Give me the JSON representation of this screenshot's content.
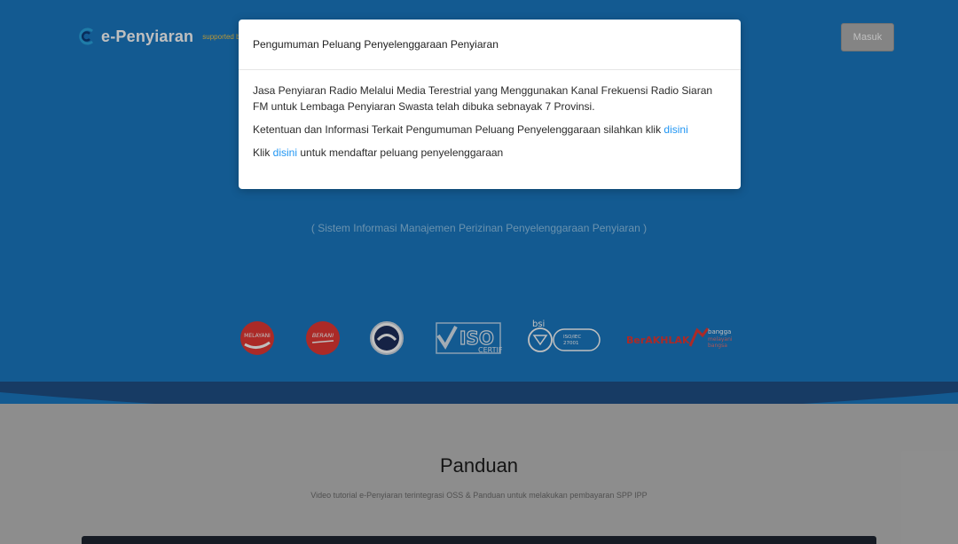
{
  "header": {
    "logo_e": "e-",
    "logo_name": "Penyiaran",
    "supported_by": "supported by",
    "login_label": "Masuk"
  },
  "hero": {
    "subtitle": "( Sistem Informasi Manajemen Perizinan Penyelenggaraan Penyiaran )",
    "badges": [
      "MELAYANI",
      "BERANI",
      "ISO 9001 2015 CERTIFIED",
      "bsi ISO/IEC 27001",
      "BerAKHLAK",
      "bangga melayani bangsa"
    ]
  },
  "modal": {
    "title": "Pengumuman Peluang Penyelenggaraan Penyiaran",
    "para1": "Jasa Penyiaran Radio Melalui Media Terestrial yang Menggunakan Kanal Frekuensi Radio Siaran FM untuk Lembaga Penyiaran Swasta telah dibuka sebnayak 7 Provinsi.",
    "para2_text": "Ketentuan dan Informasi Terkait Pengumuman Peluang Penyelenggaraan silahkan klik ",
    "para2_link": "disini",
    "para3_pre": "Klik ",
    "para3_link": "disini",
    "para3_post": " untuk mendaftar peluang penyelenggaraan"
  },
  "panduan": {
    "title": "Panduan",
    "description": "Video tutorial e-Penyiaran terintegrasi OSS & Panduan untuk melakukan pembayaran SPP IPP"
  },
  "colors": {
    "hero_blue": "#1a78c2",
    "wave_navy": "#1f4f86",
    "link_blue": "#2196f3"
  }
}
